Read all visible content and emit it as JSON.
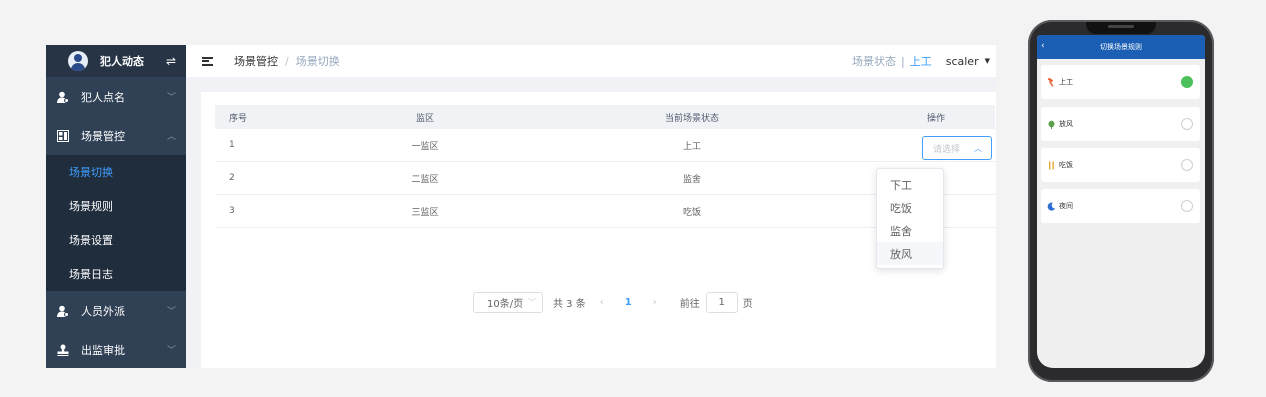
{
  "sidebar": {
    "brand": "犯人动态",
    "swap_glyph": "⇌",
    "items": [
      {
        "label": "犯人点名",
        "icon": "user-icon",
        "expanded": false
      },
      {
        "label": "场景管控",
        "icon": "grid-icon",
        "expanded": true,
        "children": [
          {
            "label": "场景切换",
            "active": true
          },
          {
            "label": "场景规则",
            "active": false
          },
          {
            "label": "场景设置",
            "active": false
          },
          {
            "label": "场景日志",
            "active": false
          }
        ]
      },
      {
        "label": "人员外派",
        "icon": "user-icon",
        "expanded": false
      },
      {
        "label": "出监审批",
        "icon": "stamp-icon",
        "expanded": false
      }
    ]
  },
  "topbar": {
    "breadcrumb": [
      "场景管控",
      "场景切换"
    ],
    "state_label": "场景状态",
    "state_sep": "|",
    "state_value": "上工",
    "user": "scaler"
  },
  "table": {
    "headers": [
      "序号",
      "监区",
      "当前场景状态",
      "操作"
    ],
    "rows": [
      {
        "no": "1",
        "area": "一监区",
        "state": "上工"
      },
      {
        "no": "2",
        "area": "二监区",
        "state": "监舍"
      },
      {
        "no": "3",
        "area": "三监区",
        "state": "吃饭"
      }
    ],
    "select_placeholder": "请选择"
  },
  "dropdown": {
    "options": [
      "下工",
      "吃饭",
      "监舍",
      "放风"
    ],
    "hovered": "放风"
  },
  "pager": {
    "page_size": "10条/页",
    "total": "共 3 条",
    "current": "1",
    "goto_prefix": "前往",
    "goto_value": "1",
    "goto_suffix": "页"
  },
  "phone": {
    "title": "切换场景规则",
    "items": [
      {
        "label": "上工",
        "icon": "hammer-icon",
        "color": "#e8663c",
        "selected": true
      },
      {
        "label": "放风",
        "icon": "plant-icon",
        "color": "#5aa04a",
        "selected": false
      },
      {
        "label": "吃饭",
        "icon": "utensils-icon",
        "color": "#e0a020",
        "selected": false
      },
      {
        "label": "夜间",
        "icon": "moon-icon",
        "color": "#2d6fd0",
        "selected": false
      }
    ]
  },
  "colors": {
    "accent": "#409eff",
    "sidebar_bg": "#304156",
    "phone_header": "#1a5fb4",
    "selected_green": "#4cc05a"
  }
}
